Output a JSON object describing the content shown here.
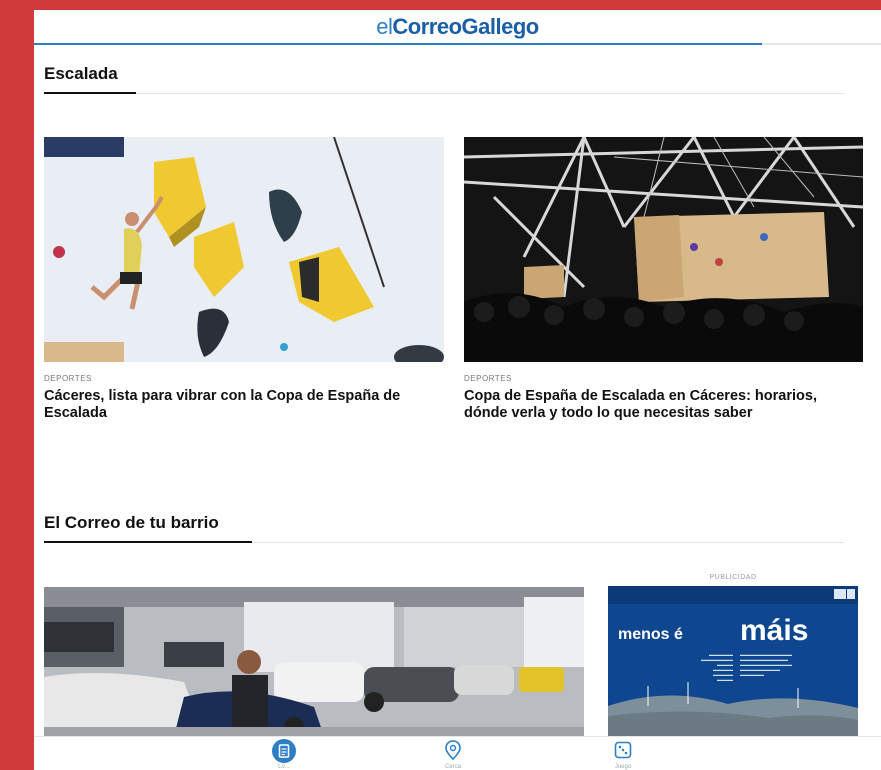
{
  "header": {
    "logo_prefix": "el",
    "logo_main": "CorreoGallego",
    "scroll_progress": 0.86
  },
  "sections": [
    {
      "title": "Escalada",
      "cards": [
        {
          "category": "DEPORTES",
          "title": "Cáceres, lista para vibrar con la Copa de España de Escalada"
        },
        {
          "category": "DEPORTES",
          "title": "Copa de España de Escalada en Cáceres: horarios, dónde verla y todo lo que necesitas saber"
        }
      ]
    },
    {
      "title": "El Correo de tu barrio"
    }
  ],
  "ad": {
    "label": "PUBLICIDAD",
    "text_left": "menos é",
    "text_right": "máis"
  },
  "tabbar": {
    "items": [
      {
        "icon": "document-icon",
        "label": "Lo..."
      },
      {
        "icon": "location-pin-icon",
        "label": "Cerca"
      },
      {
        "icon": "dice-icon",
        "label": "Juego"
      }
    ],
    "active_color": "#2d7ec4"
  },
  "colors": {
    "frame": "#d13a3a",
    "brand": "#1a5fa8"
  }
}
